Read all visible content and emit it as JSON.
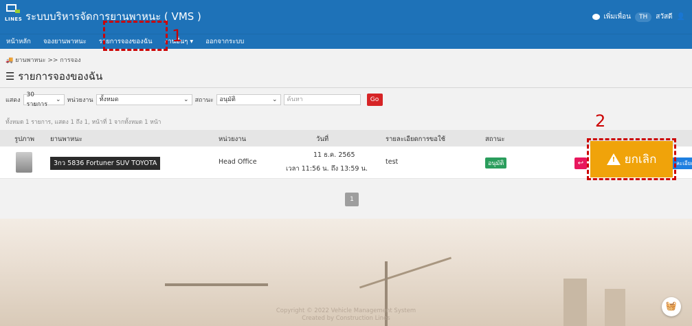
{
  "header": {
    "logo_text": "LINES",
    "app_title": "ระบบบริหารจัดการยานพาหนะ ( VMS )",
    "add_friend": "เพิ่มเพื่อน",
    "lang": "TH",
    "greeting": "สวัสดี"
  },
  "nav": {
    "items": [
      {
        "label": "หน้าหลัก"
      },
      {
        "label": "จองยานพาหนะ"
      },
      {
        "label": "รายการจองของฉัน"
      },
      {
        "label": "งานอื่นๆ ▾"
      },
      {
        "label": "ออกจากระบบ"
      }
    ]
  },
  "annotations": {
    "step1": "1",
    "step2": "2"
  },
  "breadcrumb": "🚚 ยานพาหนะ >> การจอง",
  "page_title": "รายการจองของฉัน",
  "filters": {
    "show_label": "แสดง",
    "show_value": "30 รายการ",
    "dept_label": "หน่วยงาน",
    "dept_value": "ทั้งหมด",
    "status_label": "สถานะ",
    "status_value": "อนุมัติ",
    "search_placeholder": "ค้นหา",
    "go_label": "Go"
  },
  "summary": "ทั้งหมด 1 รายการ, แสดง 1 ถึง 1, หน้าที่ 1 จากทั้งหมด 1 หน้า",
  "table": {
    "headers": [
      "รูปภาพ",
      "ยานพาหนะ",
      "หน่วยงาน",
      "วันที่",
      "รายละเอียดการขอใช้",
      "สถานะ"
    ],
    "rows": [
      {
        "vehicle": "3กว 5836 Fortuner SUV TOYOTA",
        "department": "Head Office",
        "date": "11 ธ.ค. 2565",
        "time": "เวลา 11:56 น. ถึง 13:59 น.",
        "detail": "test",
        "status": "อนุมัติ",
        "return_icon": "↩",
        "detail_btn": "ละเอียด"
      }
    ]
  },
  "cancel_button": "ยกเลิก",
  "pager": "1",
  "footer": {
    "line1": "Copyright © 2022 Vehicle Management System",
    "line2": "Created by Construction Lines"
  },
  "cart_icon": "shopping-basket-icon",
  "colors": {
    "primary": "#1e72b8",
    "go_red": "#d62426",
    "status_green": "#2a9d5c",
    "cancel_orange": "#f0a30a",
    "callout_red": "#cc0000"
  }
}
